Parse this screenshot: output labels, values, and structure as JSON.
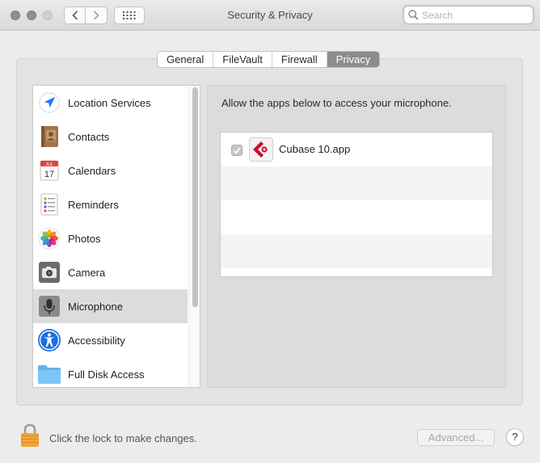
{
  "window": {
    "title": "Security & Privacy",
    "search_placeholder": "Search"
  },
  "tabs": [
    {
      "label": "General",
      "active": false
    },
    {
      "label": "FileVault",
      "active": false
    },
    {
      "label": "Firewall",
      "active": false
    },
    {
      "label": "Privacy",
      "active": true
    }
  ],
  "sidebar": {
    "items": [
      {
        "label": "Location Services",
        "icon": "location-arrow-icon",
        "selected": false
      },
      {
        "label": "Contacts",
        "icon": "contacts-book-icon",
        "selected": false
      },
      {
        "label": "Calendars",
        "icon": "calendar-icon",
        "selected": false,
        "icon_month": "JUL",
        "icon_day": "17"
      },
      {
        "label": "Reminders",
        "icon": "reminders-list-icon",
        "selected": false
      },
      {
        "label": "Photos",
        "icon": "photos-flower-icon",
        "selected": false
      },
      {
        "label": "Camera",
        "icon": "camera-icon",
        "selected": false
      },
      {
        "label": "Microphone",
        "icon": "microphone-icon",
        "selected": true
      },
      {
        "label": "Accessibility",
        "icon": "accessibility-icon",
        "selected": false
      },
      {
        "label": "Full Disk Access",
        "icon": "folder-icon",
        "selected": false
      }
    ]
  },
  "content": {
    "heading": "Allow the apps below to access your microphone.",
    "apps": [
      {
        "name": "Cubase 10.app",
        "checked": true,
        "icon": "cubase-icon"
      }
    ]
  },
  "footer": {
    "lock_text": "Click the lock to make changes.",
    "advanced_label": "Advanced...",
    "help_label": "?"
  },
  "colors": {
    "tab_active": "#8c8c8c",
    "selected_row": "#dcdcdc",
    "location_blue": "#1f7bf2",
    "cubase_red": "#c8102e"
  }
}
